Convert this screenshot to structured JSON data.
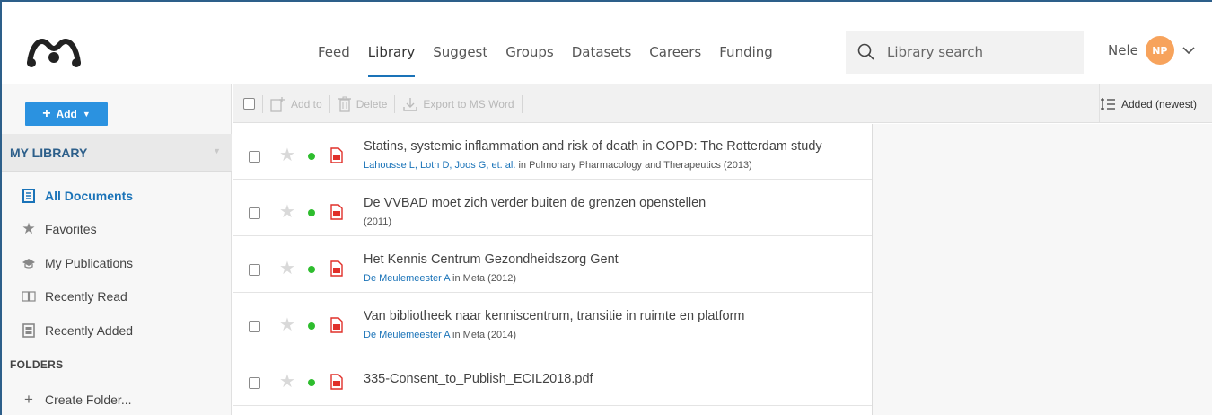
{
  "header": {
    "nav": [
      {
        "label": "Feed",
        "active": false
      },
      {
        "label": "Library",
        "active": true
      },
      {
        "label": "Suggest",
        "active": false
      },
      {
        "label": "Groups",
        "active": false
      },
      {
        "label": "Datasets",
        "active": false
      },
      {
        "label": "Careers",
        "active": false
      },
      {
        "label": "Funding",
        "active": false
      }
    ],
    "search_placeholder": "Library search",
    "user_name": "Nele",
    "user_initials": "NP"
  },
  "sidebar": {
    "add_label": "Add",
    "my_library": "MY LIBRARY",
    "items": [
      {
        "label": "All Documents",
        "icon": "documents-icon",
        "active": true
      },
      {
        "label": "Favorites",
        "icon": "star-icon",
        "active": false
      },
      {
        "label": "My Publications",
        "icon": "graduation-cap-icon",
        "active": false
      },
      {
        "label": "Recently Read",
        "icon": "book-icon",
        "active": false
      },
      {
        "label": "Recently Added",
        "icon": "inbox-icon",
        "active": false
      }
    ],
    "folders_heading": "FOLDERS",
    "create_folder": "Create Folder..."
  },
  "toolbar": {
    "add_to": "Add to",
    "delete": "Delete",
    "export": "Export to MS Word",
    "sort": "Added (newest)"
  },
  "documents": [
    {
      "title": "Statins, systemic inflammation and risk of death in COPD: The Rotterdam study",
      "authors": "Lahousse L, Loth D, Joos G, et. al.",
      "rest": " in Pulmonary Pharmacology and Therapeutics (2013)"
    },
    {
      "title": "De VVBAD moet zich verder buiten de grenzen openstellen",
      "authors": "",
      "rest": "(2011)"
    },
    {
      "title": "Het Kennis Centrum Gezondheidszorg Gent",
      "authors": "De Meulemeester A",
      "rest": " in Meta (2012)"
    },
    {
      "title": "Van bibliotheek naar kenniscentrum, transitie in ruimte en platform",
      "authors": "De Meulemeester A",
      "rest": " in Meta (2014)"
    },
    {
      "title": "335-Consent_to_Publish_ECIL2018.pdf",
      "authors": "",
      "rest": ""
    }
  ],
  "colors": {
    "accent": "#1a73b8",
    "add_button": "#2b92e0",
    "avatar": "#f7a35c",
    "read_dot": "#2ebd2e",
    "pdf": "#e0302a"
  }
}
